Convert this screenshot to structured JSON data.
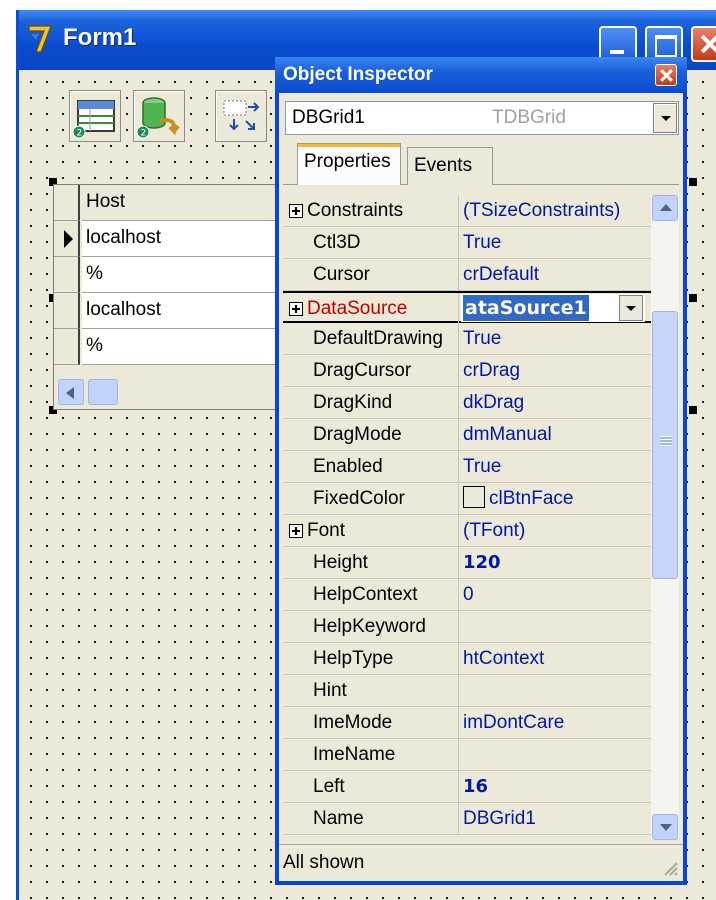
{
  "form": {
    "title": "Form1",
    "colors": {
      "titlebar": "#0a4ccf",
      "client": "#ece9d8"
    }
  },
  "components": [
    {
      "name": "dbgrid-component-icon",
      "icon": "table-icon"
    },
    {
      "name": "database-component-icon",
      "icon": "database-undo-icon"
    },
    {
      "name": "navigator-component-icon",
      "icon": "arrows-icon"
    }
  ],
  "grid": {
    "header": "Host",
    "rows": [
      "localhost",
      "%",
      "localhost",
      "%"
    ],
    "current_row": 0
  },
  "inspector": {
    "title": "Object Inspector",
    "object_name": "DBGrid1",
    "object_type": "TDBGrid",
    "tabs": [
      "Properties",
      "Events"
    ],
    "active_tab": "Properties",
    "properties": [
      {
        "name": "Constraints",
        "value": "(TSizeConstraints)",
        "expandable": true
      },
      {
        "name": "Ctl3D",
        "value": "True"
      },
      {
        "name": "Cursor",
        "value": "crDefault"
      },
      {
        "name": "DataSource",
        "value": "ataSource1",
        "expandable": true,
        "selected": true
      },
      {
        "name": "DefaultDrawing",
        "value": "True"
      },
      {
        "name": "DragCursor",
        "value": "crDrag"
      },
      {
        "name": "DragKind",
        "value": "dkDrag"
      },
      {
        "name": "DragMode",
        "value": "dmManual"
      },
      {
        "name": "Enabled",
        "value": "True"
      },
      {
        "name": "FixedColor",
        "value": "clBtnFace",
        "swatch": true
      },
      {
        "name": "Font",
        "value": "(TFont)",
        "expandable": true
      },
      {
        "name": "Height",
        "value": "120",
        "bold": true
      },
      {
        "name": "HelpContext",
        "value": "0"
      },
      {
        "name": "HelpKeyword",
        "value": ""
      },
      {
        "name": "HelpType",
        "value": "htContext"
      },
      {
        "name": "Hint",
        "value": ""
      },
      {
        "name": "ImeMode",
        "value": "imDontCare"
      },
      {
        "name": "ImeName",
        "value": ""
      },
      {
        "name": "Left",
        "value": "16",
        "bold": true
      },
      {
        "name": "Name",
        "value": "DBGrid1"
      }
    ],
    "status": "All shown",
    "colors": {
      "value_text": "#0018a8",
      "selected_name": "#c00000",
      "selection": "#316ac5"
    }
  }
}
